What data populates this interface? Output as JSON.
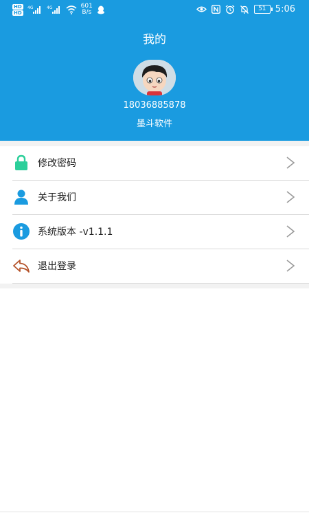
{
  "statusbar": {
    "hd1": "HD",
    "hd2": "HD",
    "net1": "4G",
    "net2": "4G",
    "speed_value": "601",
    "speed_unit": "B/s",
    "battery": "51",
    "time": "5:06"
  },
  "header": {
    "title": "我的",
    "phone": "18036885878",
    "company": "墨斗软件"
  },
  "menu": [
    {
      "label": "修改密码",
      "icon": "lock-icon",
      "color": "#2ccf9a"
    },
    {
      "label": "关于我们",
      "icon": "user-icon",
      "color": "#1a9be0"
    },
    {
      "label": "系统版本 -v1.1.1",
      "icon": "info-icon",
      "color": "#1a9be0"
    },
    {
      "label": "退出登录",
      "icon": "logout-icon",
      "color": "#b5532a"
    }
  ],
  "colors": {
    "header_bg": "#1a9be0",
    "chevron": "#9a9a9a"
  }
}
